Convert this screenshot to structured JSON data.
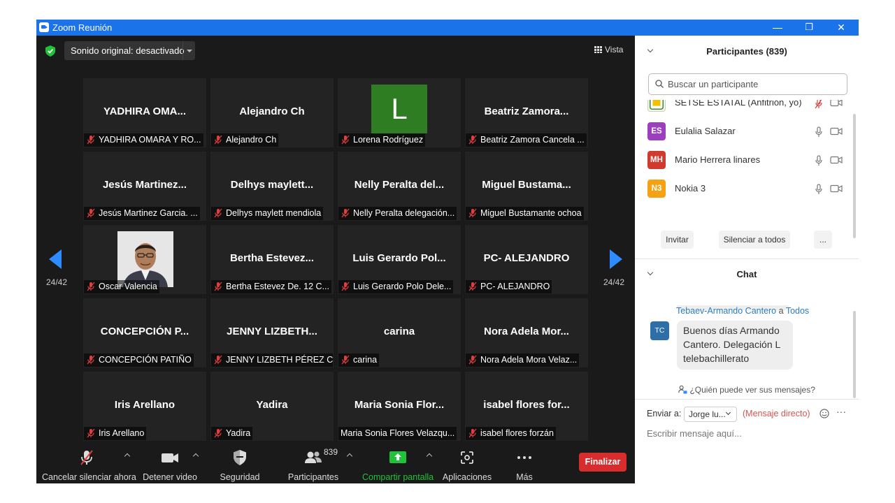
{
  "window": {
    "title": "Zoom Reunión",
    "minimize": "—",
    "restore": "❐",
    "close": "✕"
  },
  "meeting": {
    "sound_dropdown": "Sonido original: desactivado",
    "view_label": "Vista",
    "page_left": "24/42",
    "page_right": "24/42",
    "tiles": [
      {
        "big": "YADHIRA OMA...",
        "label": "YADHIRA OMARA Y RO..."
      },
      {
        "big": "Alejandro Ch",
        "label": "Alejandro Ch"
      },
      {
        "avatar_letter": "L",
        "label": "Lorena Rodríguez"
      },
      {
        "big": "Beatriz Zamora...",
        "label": "Beatriz Zamora Cancela ..."
      },
      {
        "big": "Jesús Martinez...",
        "label": "Jesús Martinez Garcia. ..."
      },
      {
        "big": "Delhys maylett...",
        "label": "Delhys maylett mendiola"
      },
      {
        "big": "Nelly Peralta del...",
        "label": "Nelly Peralta delegación..."
      },
      {
        "big": "Miguel Bustama...",
        "label": "Miguel Bustamante ochoa"
      },
      {
        "photo": true,
        "label": "Oscar Valencia"
      },
      {
        "big": "Bertha Estevez...",
        "label": "Bertha Estevez De. 12 C..."
      },
      {
        "big": "Luis Gerardo Pol...",
        "label": "Luis Gerardo Polo Dele..."
      },
      {
        "big": "PC- ALEJANDRO",
        "label": "PC- ALEJANDRO"
      },
      {
        "big": "CONCEPCIÓN P...",
        "label": "CONCEPCIÓN PATIÑO"
      },
      {
        "big": "JENNY LIZBETH...",
        "label": "JENNY LIZBETH PÉREZ C..."
      },
      {
        "big": "carina",
        "label": "carina"
      },
      {
        "big": "Nora Adela Mor...",
        "label": "Nora Adela Mora Velaz..."
      },
      {
        "big": "Iris Arellano",
        "label": "Iris Arellano"
      },
      {
        "big": "Yadira",
        "label": "Yadira"
      },
      {
        "big": "Maria Sonia Flor...",
        "label": "Maria Sonia Flores Velazqu...",
        "no_mic": true
      },
      {
        "big": "isabel flores for...",
        "label": "isabel flores forzán"
      }
    ]
  },
  "toolbar": {
    "unmute": "Cancelar silenciar ahora",
    "video": "Detener video",
    "security": "Seguridad",
    "participants": "Participantes",
    "participants_count": "839",
    "share": "Compartir pantalla",
    "apps": "Aplicaciones",
    "more": "Más",
    "end": "Finalizar"
  },
  "participants_panel": {
    "title": "Participantes (839)",
    "search_placeholder": "Buscar un participante",
    "rows": [
      {
        "initials": "",
        "name": "SETSE ESTATAL (Anfitrión, yo)",
        "color": "#f5f5dc",
        "host": true
      },
      {
        "initials": "ES",
        "name": "Eulalia Salazar",
        "color": "#9c3fbf"
      },
      {
        "initials": "MH",
        "name": "Mario Herrera linares",
        "color": "#d13a2f"
      },
      {
        "initials": "N3",
        "name": "Nokia 3",
        "color": "#f4a213"
      }
    ],
    "invite": "Invitar",
    "mute_all": "Silenciar a todos",
    "more": "..."
  },
  "chat": {
    "title": "Chat",
    "from": "Tebaev-Armando Cantero",
    "to_word": "a",
    "to": "Todos",
    "avatar": "TC",
    "message": "Buenos días Armando Cantero. Delegación L telebachillerato",
    "who_sees": "¿Quién puede ver sus mensajes?",
    "send_to_label": "Enviar a:",
    "send_to_value": "Jorge lu...",
    "direct_label": "(Mensaje directo)",
    "more": "···",
    "input_placeholder": "Escribir mensaje aquí..."
  },
  "colors": {
    "accent": "#2d8cff",
    "title_bar": "#1a73e8",
    "end_button": "#d92d2d",
    "share_green": "#22c13a"
  }
}
